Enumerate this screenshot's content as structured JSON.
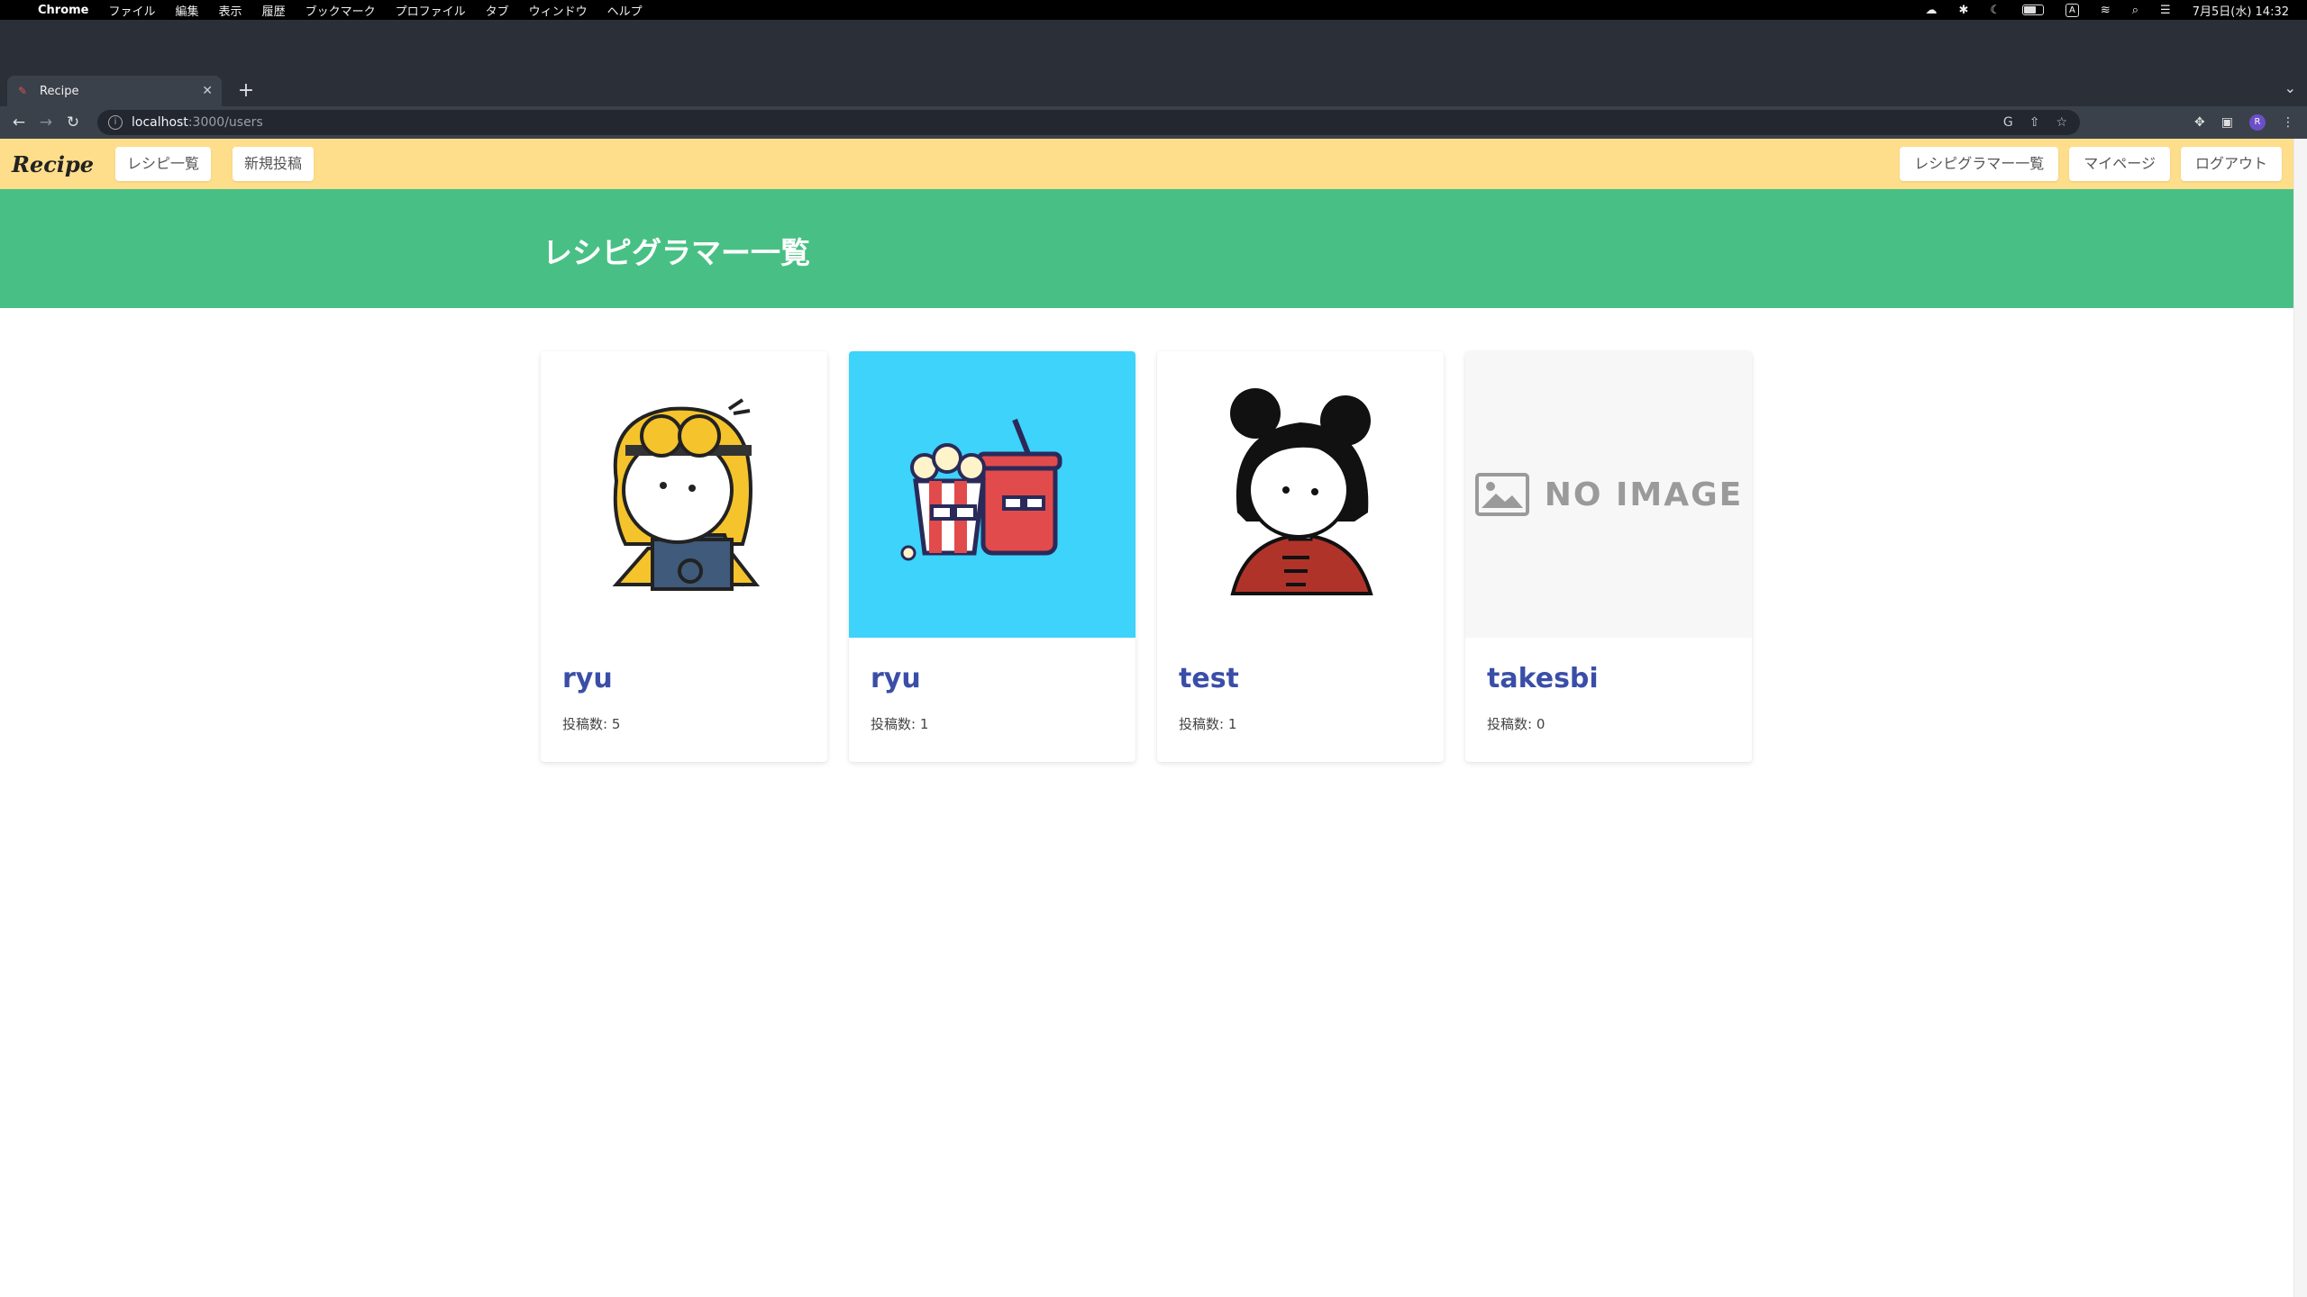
{
  "menubar": {
    "app_name": "Chrome",
    "menus": [
      "ファイル",
      "編集",
      "表示",
      "履歴",
      "ブックマーク",
      "プロファイル",
      "タブ",
      "ウィンドウ",
      "ヘルプ"
    ],
    "datetime": "7月5日(水) 14:32"
  },
  "browser": {
    "tab_title": "Recipe",
    "url_host": "localhost",
    "url_path": ":3000/users",
    "profile_initial": "R"
  },
  "site": {
    "brand": "Recipe",
    "nav_left": [
      "レシピ一覧",
      "新規投稿"
    ],
    "nav_right": [
      "レシピグラマー一覧",
      "マイページ",
      "ログアウト"
    ]
  },
  "page": {
    "title": "レシピグラマー一覧"
  },
  "users": [
    {
      "name": "ryu",
      "posts": "投稿数: 5",
      "image": "minion-girl-avatar"
    },
    {
      "name": "ryu",
      "posts": "投稿数: 1",
      "image": "popcorn-drink-avatar"
    },
    {
      "name": "test",
      "posts": "投稿数: 1",
      "image": "bun-hair-girl-avatar"
    },
    {
      "name": "takesbi",
      "posts": "投稿数: 0",
      "image": "no-image-placeholder",
      "placeholder_text": "NO IMAGE"
    }
  ],
  "colors": {
    "nav_bg": "#fede8b",
    "hero_bg": "#48c085",
    "name_link": "#3a4ea8",
    "avatar_blue_bg": "#3dd3fa"
  }
}
